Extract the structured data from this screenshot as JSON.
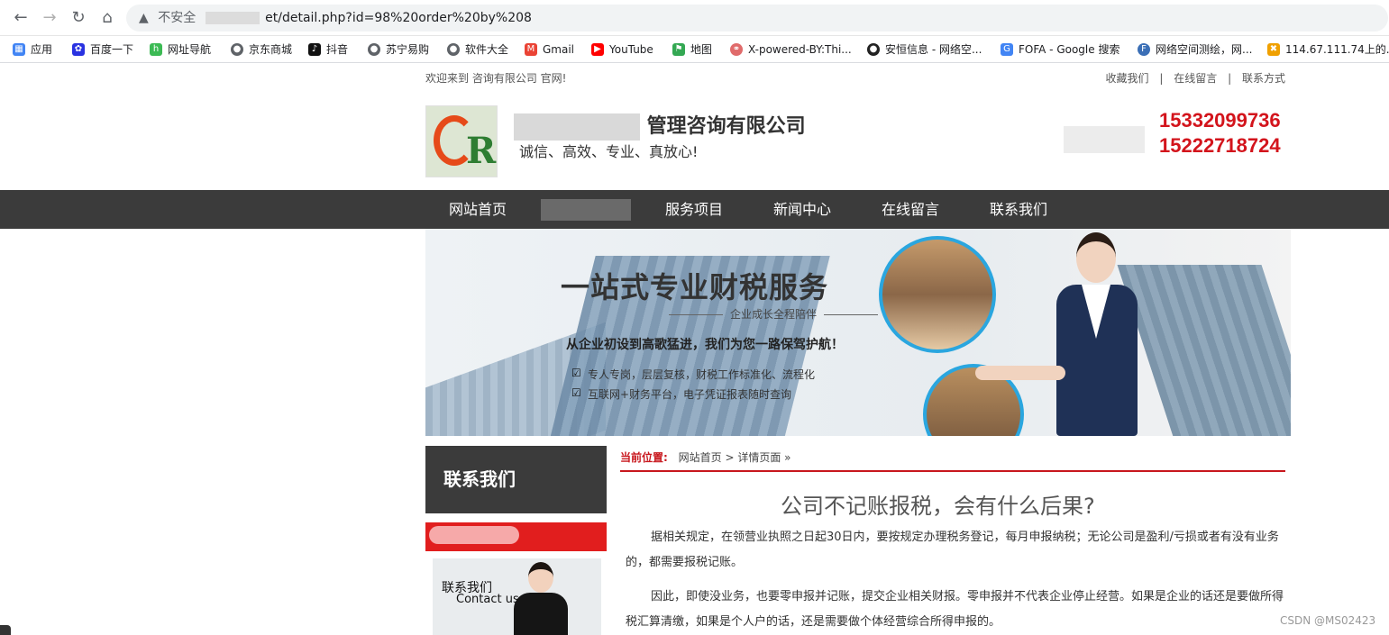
{
  "browser": {
    "security": "不安全",
    "url_visible": "et/detail.php?id=98%20order%20by%208",
    "bookmarks": [
      {
        "label": "应用",
        "icon": "apps-grid-icon",
        "color": "#4285f4"
      },
      {
        "label": "百度一下",
        "icon": "baidu-paw-icon",
        "color": "#2932e1"
      },
      {
        "label": "网址导航",
        "icon": "hao123-icon",
        "color": "#3cba54"
      },
      {
        "label": "京东商城",
        "icon": "globe-icon",
        "color": "#5f6368"
      },
      {
        "label": "抖音",
        "icon": "tiktok-icon",
        "color": "#111111"
      },
      {
        "label": "苏宁易购",
        "icon": "globe-icon",
        "color": "#5f6368"
      },
      {
        "label": "软件大全",
        "icon": "globe-icon",
        "color": "#5f6368"
      },
      {
        "label": "Gmail",
        "icon": "gmail-icon",
        "color": "#ea4335"
      },
      {
        "label": "YouTube",
        "icon": "youtube-icon",
        "color": "#ff0000"
      },
      {
        "label": "地图",
        "icon": "maps-icon",
        "color": "#34a853"
      },
      {
        "label": "X-powered-BY:Thi...",
        "icon": "link-icon",
        "color": "#e06b6b"
      },
      {
        "label": "安恒信息 - 网络空...",
        "icon": "anheng-icon",
        "color": "#222222"
      },
      {
        "label": "FOFA - Google 搜索",
        "icon": "google-icon",
        "color": "#4285f4"
      },
      {
        "label": "网络空间测绘，网...",
        "icon": "fofa-icon",
        "color": "#3b6fb6"
      },
      {
        "label": "114.67.111.74上的...",
        "icon": "site-icon",
        "color": "#f0a000"
      }
    ]
  },
  "site": {
    "topbar": {
      "welcome": "欢迎来到 咨询有限公司 官网!",
      "links": [
        "收藏我们",
        "|",
        "在线留言",
        "|",
        "联系方式"
      ]
    },
    "company_name": "管理咨询有限公司",
    "slogan": "诚信、高效、专业、真放心!",
    "phones": [
      "15332099736",
      "15222718724"
    ],
    "nav": [
      "网站首页",
      "服务项目",
      "新闻中心",
      "在线留言",
      "联系我们"
    ],
    "banner": {
      "title": "一站式专业财税服务",
      "subtitle": "企业成长全程陪伴",
      "slogan": "从企业初设到高歌猛进，我们为您一路保驾护航！",
      "points": [
        "专人专岗，层层复核，财税工作标准化、流程化",
        "互联网+财务平台，电子凭证报表随时查询"
      ]
    },
    "sidebar": {
      "title": "联系我们",
      "card_text_1": "联系我们",
      "card_text_2": "Contact us"
    },
    "breadcrumb": {
      "label": "当前位置:",
      "path": "网站首页 > 详情页面 »"
    },
    "article": {
      "title": "公司不记账报税，会有什么后果?",
      "paragraphs": [
        "据相关规定，在领营业执照之日起30日内，要按规定办理税务登记，每月申报纳税；无论公司是盈利/亏损或者有没有业务的，都需要报税记账。",
        "因此，即使没业务，也要零申报并记账，提交企业相关财报。零申报并不代表企业停止经营。如果是企业的话还是要做所得税汇算清缴，如果是个人户的话，还是需要做个体经营综合所得申报的。"
      ]
    }
  },
  "watermark": "CSDN @MS02423"
}
